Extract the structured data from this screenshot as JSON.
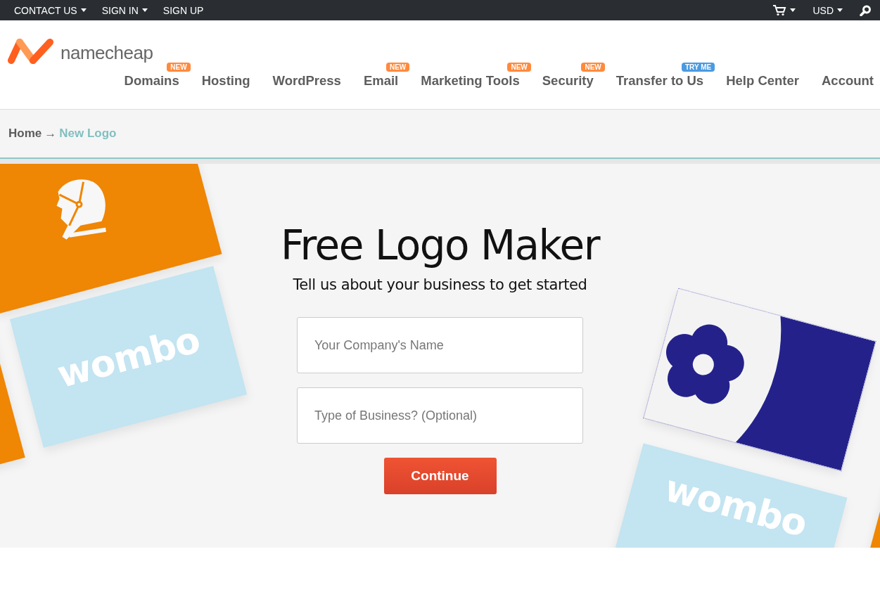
{
  "top_bar": {
    "left": [
      {
        "label": "CONTACT US",
        "dropdown": true
      },
      {
        "label": "SIGN IN",
        "dropdown": true
      },
      {
        "label": "SIGN UP",
        "dropdown": false
      }
    ],
    "currency": "USD"
  },
  "header": {
    "logo_text": "namecheap",
    "nav": [
      {
        "label": "Domains",
        "badge": {
          "text": "NEW",
          "color": "#ff8a3d"
        }
      },
      {
        "label": "Hosting"
      },
      {
        "label": "WordPress"
      },
      {
        "label": "Email",
        "badge": {
          "text": "NEW",
          "color": "#ff8a3d"
        }
      },
      {
        "label": "Marketing Tools",
        "badge": {
          "text": "NEW",
          "color": "#ff8a3d"
        }
      },
      {
        "label": "Security",
        "badge": {
          "text": "NEW",
          "color": "#ff8a3d"
        }
      },
      {
        "label": "Transfer to Us",
        "badge": {
          "text": "TRY ME",
          "color": "#4b9ae0"
        }
      },
      {
        "label": "Help Center"
      },
      {
        "label": "Account"
      }
    ]
  },
  "breadcrumb": [
    {
      "label": "Home",
      "current": false
    },
    {
      "label": "New Logo",
      "current": true
    }
  ],
  "breadcrumb_separator": "→",
  "hero": {
    "title": "Free Logo Maker",
    "subtitle": "Tell us about your business to get started",
    "fields": [
      {
        "placeholder": "Your Company's Name"
      },
      {
        "placeholder": "Type of Business? (Optional)"
      }
    ],
    "button": "Continue",
    "cards": [
      {
        "kind": "astronaut"
      },
      {
        "kind": "wordmark",
        "text": "wombo"
      },
      {
        "kind": "plain"
      },
      {
        "kind": "flower"
      },
      {
        "kind": "wordmark",
        "text": "wombo"
      },
      {
        "kind": "plain"
      }
    ]
  }
}
